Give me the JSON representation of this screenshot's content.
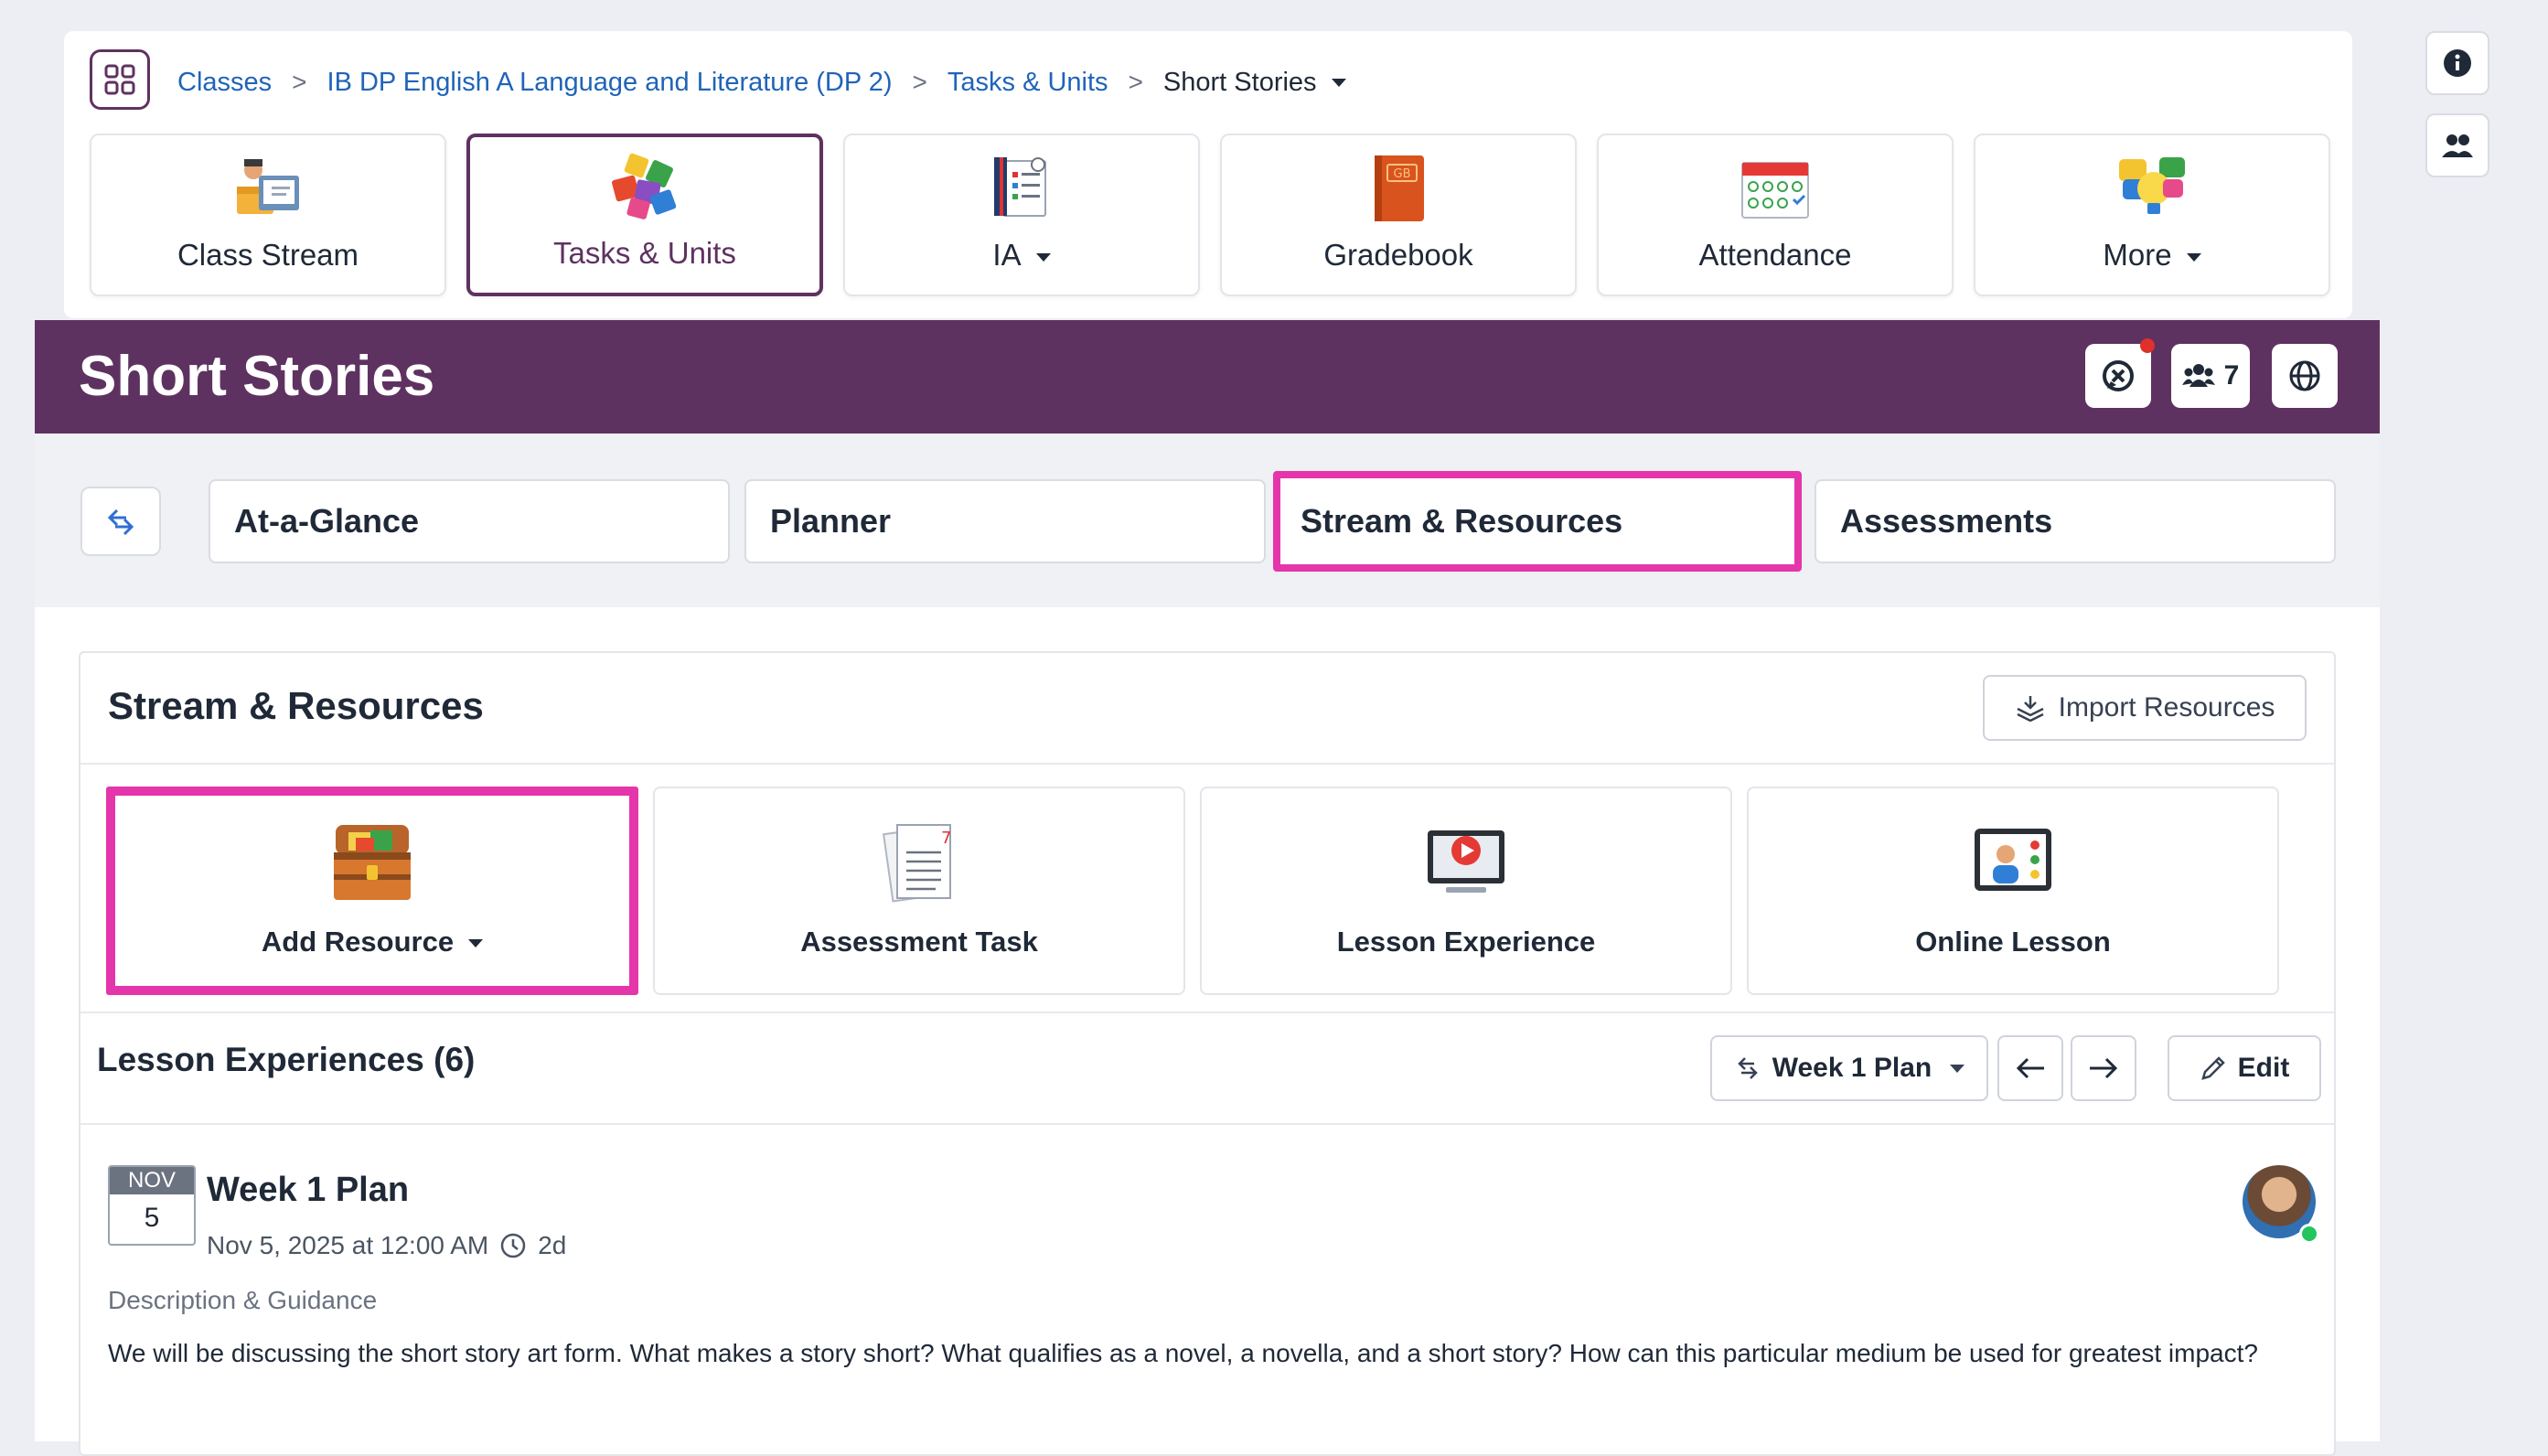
{
  "breadcrumb": {
    "items": [
      "Classes",
      "IB DP English A Language and Literature (DP 2)",
      "Tasks & Units"
    ],
    "current": "Short Stories",
    "separator": ">"
  },
  "class_tiles": [
    {
      "label": "Class Stream",
      "icon": "class-stream-icon"
    },
    {
      "label": "Tasks & Units",
      "icon": "puzzle-icon"
    },
    {
      "label": "IA",
      "icon": "ia-icon"
    },
    {
      "label": "Gradebook",
      "icon": "gradebook-icon"
    },
    {
      "label": "Attendance",
      "icon": "attendance-calendar-icon"
    },
    {
      "label": "More",
      "icon": "lightbulb-icon"
    }
  ],
  "unit": {
    "title": "Short Stories",
    "participants_count": "7"
  },
  "subtabs": [
    "At-a-Glance",
    "Planner",
    "Stream & Resources",
    "Assessments"
  ],
  "stream": {
    "title": "Stream & Resources",
    "import_label": "Import Resources",
    "resources": [
      {
        "label": "Add Resource",
        "icon": "treasure-chest-icon"
      },
      {
        "label": "Assessment Task",
        "icon": "assessment-doc-icon"
      },
      {
        "label": "Lesson Experience",
        "icon": "video-monitor-icon"
      },
      {
        "label": "Online Lesson",
        "icon": "online-lesson-icon"
      }
    ]
  },
  "lesson_experiences": {
    "title": "Lesson Experiences (6)",
    "plan_select": "Week 1 Plan",
    "edit_label": "Edit"
  },
  "lesson": {
    "month": "NOV",
    "day": "5",
    "title": "Week 1 Plan",
    "datetime": "Nov 5, 2025 at 12:00 AM",
    "duration": "2d",
    "desc_label": "Description & Guidance",
    "description": "We will be discussing the short story art form. What makes a story short? What qualifies as a novel, a novella, and a short story? How can this particular medium be used for greatest impact?"
  },
  "colors": {
    "brand_purple": "#5e3260",
    "highlight_pink": "#e535ab",
    "link_blue": "#1f64b8"
  }
}
